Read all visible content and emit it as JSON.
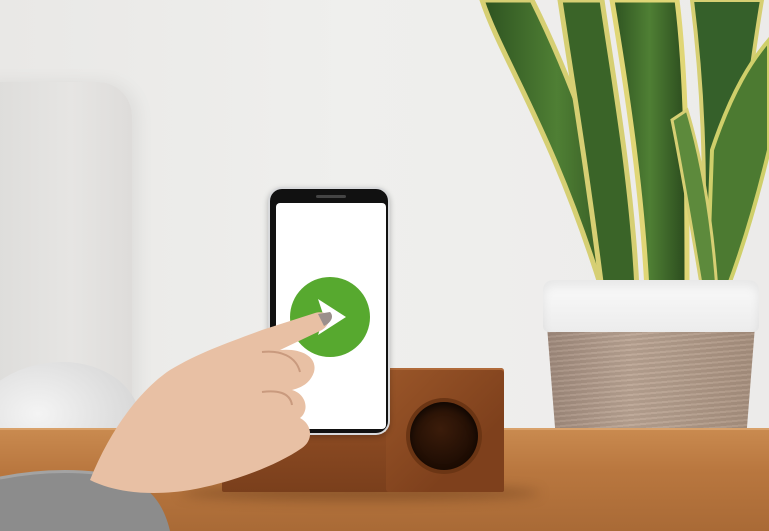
{
  "scene": {
    "subject": "smartphone-in-wooden-speaker-dock",
    "colors": {
      "wall": "#ecebea",
      "table_wood": "#b9773f",
      "dock_wood": "#8b4a22",
      "play_green": "#57a92f",
      "leaf_green": "#3f6b2a",
      "leaf_edge": "#d9d277",
      "pot_rim": "#f5f5f5",
      "pot_rope": "#b09a89",
      "sweater": "#8c8c8c",
      "skin": "#e8c0a4"
    },
    "icons": [
      "play-icon"
    ]
  }
}
